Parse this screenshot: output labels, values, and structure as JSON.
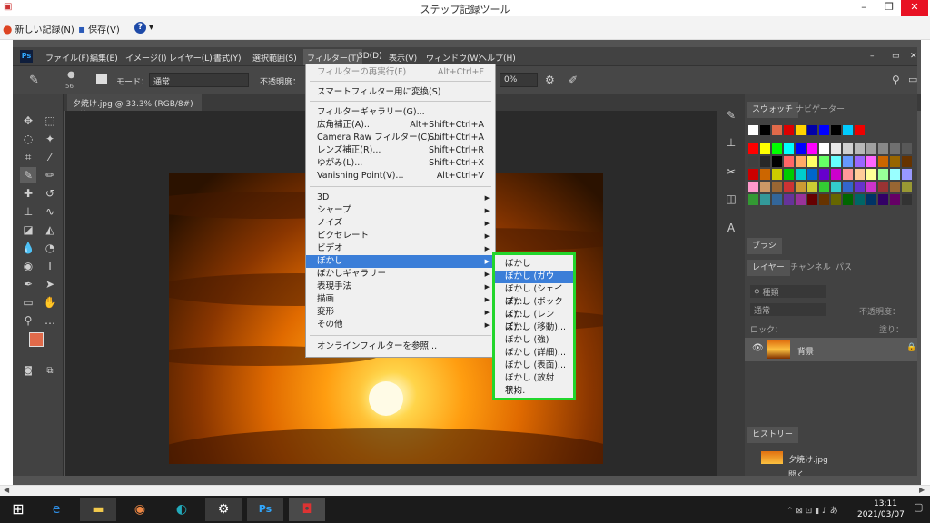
{
  "psr": {
    "title": "ステップ記録ツール",
    "new_record": "新しい記録(N)",
    "save": "保存(V)",
    "help": "?"
  },
  "ps": {
    "menubar": [
      "ファイル(F)",
      "編集(E)",
      "イメージ(I)",
      "レイヤー(L)",
      "書式(Y)",
      "選択範囲(S)",
      "フィルター(T)",
      "3D(D)",
      "表示(V)",
      "ウィンドウ(W)",
      "ヘルプ(H)"
    ],
    "options": {
      "mode_label": "モード：",
      "mode_value": "通常",
      "opacity_label": "不透明度：",
      "size": "56",
      "flow": "0%"
    },
    "doc_tab": "夕焼け.jpg @ 33.3% (RGB/8#)",
    "doc_tab_close": "×"
  },
  "filter_menu": {
    "items": [
      {
        "label": "フィルターの再実行(F)",
        "shortcut": "Alt+Ctrl+F"
      },
      {
        "label": "スマートフィルター用に変換(S)",
        "shortcut": ""
      },
      {
        "label": "フィルターギャラリー(G)...",
        "shortcut": ""
      },
      {
        "label": "広角補正(A)...",
        "shortcut": "Alt+Shift+Ctrl+A"
      },
      {
        "label": "Camera Raw フィルター(C)...",
        "shortcut": "Shift+Ctrl+A"
      },
      {
        "label": "レンズ補正(R)...",
        "shortcut": "Shift+Ctrl+R"
      },
      {
        "label": "ゆがみ(L)...",
        "shortcut": "Shift+Ctrl+X"
      },
      {
        "label": "Vanishing Point(V)...",
        "shortcut": "Alt+Ctrl+V"
      },
      {
        "label": "3D"
      },
      {
        "label": "シャープ"
      },
      {
        "label": "ノイズ"
      },
      {
        "label": "ピクセレート"
      },
      {
        "label": "ビデオ"
      },
      {
        "label": "ぼかし"
      },
      {
        "label": "ぼかしギャラリー"
      },
      {
        "label": "表現手法"
      },
      {
        "label": "描画"
      },
      {
        "label": "変形"
      },
      {
        "label": "その他"
      },
      {
        "label": "オンラインフィルターを参照..."
      }
    ]
  },
  "blur_submenu": [
    "ぼかし",
    "ぼかし (ガウス)...",
    "ぼかし (シェイプ)...",
    "ぼかし (ボックス)...",
    "ぼかし (レンズ)...",
    "ぼかし (移動)...",
    "ぼかし (強)",
    "ぼかし (詳細)...",
    "ぼかし (表面)...",
    "ぼかし (放射状)...",
    "平均"
  ],
  "panels": {
    "swatches_tab": "スウォッチ",
    "navigator_tab": "ナビゲーター",
    "brush_tab": "ブラシ",
    "layers_tab": "レイヤー",
    "channels_tab": "チャンネル",
    "paths_tab": "パス",
    "kind_filter": "種類",
    "blend": "通常",
    "opacity_label": "不透明度：",
    "lock_label": "ロック：",
    "fill_label": "塗り：",
    "layer_name": "背景",
    "history_tab": "ヒストリー",
    "history_item1": "夕焼け.jpg",
    "history_item2": "開く"
  },
  "taskbar": {
    "time": "13:11",
    "date": "2021/03/07"
  },
  "colors": {
    "highlight": "#3b7ed8",
    "green_box": "#22d62c",
    "fg_color": "#e06a4a"
  }
}
